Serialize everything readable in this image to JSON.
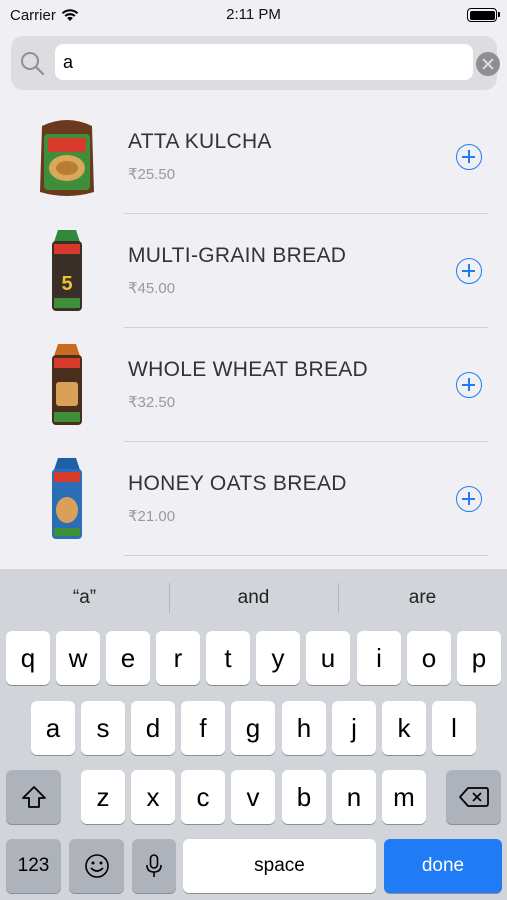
{
  "status": {
    "carrier": "Carrier",
    "time": "2:11 PM"
  },
  "search": {
    "value": "a",
    "placeholder": ""
  },
  "products": [
    {
      "name": "ATTA KULCHA",
      "price": "₹25.50"
    },
    {
      "name": "MULTI-GRAIN BREAD",
      "price": "₹45.00"
    },
    {
      "name": "WHOLE WHEAT BREAD",
      "price": "₹32.50"
    },
    {
      "name": "HONEY OATS BREAD",
      "price": "₹21.00"
    }
  ],
  "keyboard": {
    "suggestions": [
      "“a”",
      "and",
      "are"
    ],
    "row1": [
      "q",
      "w",
      "e",
      "r",
      "t",
      "y",
      "u",
      "i",
      "o",
      "p"
    ],
    "row2": [
      "a",
      "s",
      "d",
      "f",
      "g",
      "h",
      "j",
      "k",
      "l"
    ],
    "row3": [
      "z",
      "x",
      "c",
      "v",
      "b",
      "n",
      "m"
    ],
    "numbers_label": "123",
    "space_label": "space",
    "done_label": "done"
  },
  "colors": {
    "accent": "#1f7cf6",
    "background": "#efeff4",
    "keyboard": "#d1d4d9"
  }
}
